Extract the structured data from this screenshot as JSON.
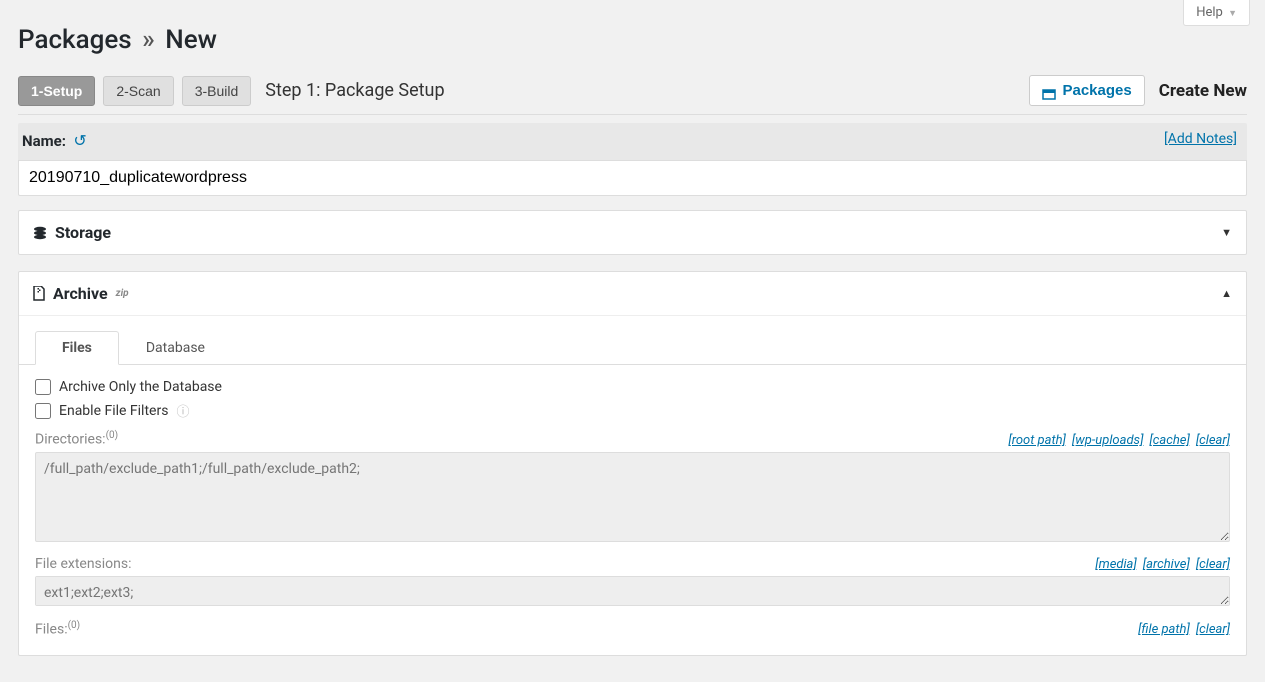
{
  "help": {
    "label": "Help"
  },
  "page_title": {
    "main": "Packages",
    "sep": "»",
    "sub": "New"
  },
  "steps": {
    "items": [
      "1-Setup",
      "2-Scan",
      "3-Build"
    ],
    "current_title": "Step 1: Package Setup",
    "active_index": 0
  },
  "toolbar": {
    "packages_label": "Packages",
    "create_new_label": "Create New"
  },
  "name_section": {
    "label": "Name:",
    "value": "20190710_duplicatewordpress",
    "add_notes": "[Add Notes]"
  },
  "storage": {
    "title": "Storage"
  },
  "archive": {
    "title": "Archive",
    "format": "zip",
    "tabs": [
      "Files",
      "Database"
    ],
    "files": {
      "archive_only_db": "Archive Only the Database",
      "enable_filters": "Enable File Filters",
      "directories_label": "Directories:",
      "directories_count": "(0)",
      "directories_links": [
        "[root path]",
        "[wp-uploads]",
        "[cache]",
        "[clear]"
      ],
      "directories_placeholder": "/full_path/exclude_path1;/full_path/exclude_path2;",
      "file_ext_label": "File extensions:",
      "file_ext_links": [
        "[media]",
        "[archive]",
        "[clear]"
      ],
      "file_ext_placeholder": "ext1;ext2;ext3;",
      "files_label": "Files:",
      "files_count": "(0)",
      "files_links": [
        "[file path]",
        "[clear]"
      ]
    }
  }
}
